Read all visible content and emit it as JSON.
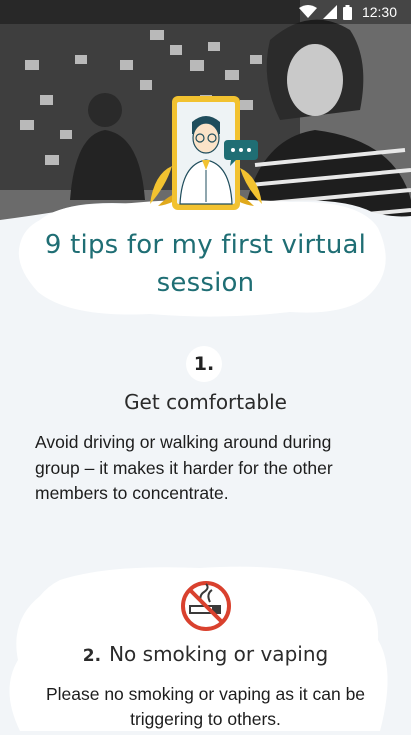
{
  "status_bar": {
    "time": "12:30",
    "icons": [
      "wifi-icon",
      "cellular-signal-icon",
      "battery-icon"
    ]
  },
  "header": {
    "title": "9 tips for my first virtual session"
  },
  "tips": [
    {
      "number": "1.",
      "heading": "Get comfortable",
      "body": "Avoid driving or walking around during group – it makes it harder for the other members to concentrate."
    },
    {
      "number": "2.",
      "heading": "No smoking or vaping",
      "body": "Please no smoking or vaping as it can be triggering to others.",
      "icon": "no-smoking-icon"
    }
  ],
  "colors": {
    "title": "#1f6e74",
    "background": "#f2f5f8",
    "accent_gold": "#f2c230",
    "no_smoking_red": "#d9412e"
  }
}
